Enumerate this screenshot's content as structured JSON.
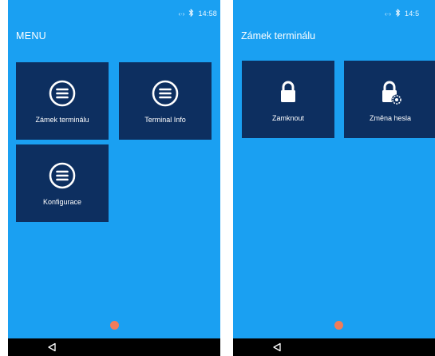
{
  "colors": {
    "background": "#1aa0f2",
    "tile": "#0d2f60",
    "page_indicator": "#f07c5a",
    "nav_bar": "#000000"
  },
  "left_screen": {
    "status_bar": {
      "time": "14:58",
      "icons": [
        "vibrate-icon",
        "bluetooth-icon"
      ]
    },
    "title": "MENU",
    "tiles": [
      {
        "label": "Zámek terminálu",
        "icon": "menu-circle-icon"
      },
      {
        "label": "Terminal Info",
        "icon": "menu-circle-icon"
      },
      {
        "label": "Konfigurace",
        "icon": "menu-circle-icon"
      }
    ],
    "nav": {
      "back_icon": "back-triangle-icon"
    }
  },
  "right_screen": {
    "status_bar": {
      "time": "14:5",
      "icons": [
        "vibrate-icon",
        "bluetooth-icon"
      ]
    },
    "title": "Zámek terminálu",
    "tiles": [
      {
        "label": "Zamknout",
        "icon": "lock-icon"
      },
      {
        "label": "Změna hesla",
        "icon": "lock-settings-icon"
      }
    ],
    "nav": {
      "back_icon": "back-triangle-icon"
    }
  }
}
